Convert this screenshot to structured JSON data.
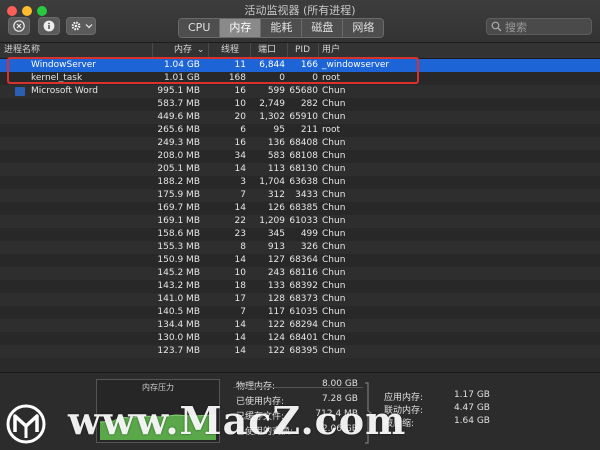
{
  "window": {
    "title": "活动监视器 (所有进程)"
  },
  "toolbar": {
    "close_icon": "x-circle-icon",
    "info_icon": "info-icon",
    "gear_icon": "gear-icon",
    "tabs": [
      {
        "label": "CPU",
        "active": false
      },
      {
        "label": "内存",
        "active": true
      },
      {
        "label": "能耗",
        "active": false
      },
      {
        "label": "磁盘",
        "active": false
      },
      {
        "label": "网络",
        "active": false
      }
    ],
    "search_placeholder": "搜索"
  },
  "table": {
    "headers": {
      "name": "进程名称",
      "memory": "内存",
      "threads": "线程",
      "ports": "端口",
      "pid": "PID",
      "user": "用户"
    },
    "sort_indicator": "⌄",
    "rows": [
      {
        "name": "WindowServer",
        "memory": "1.04 GB",
        "threads": "11",
        "ports": "6,844",
        "pid": "166",
        "user": "_windowserver",
        "selected": true
      },
      {
        "name": "kernel_task",
        "memory": "1.01 GB",
        "threads": "168",
        "ports": "0",
        "pid": "0",
        "user": "root"
      },
      {
        "name": "Microsoft Word",
        "memory": "995.1 MB",
        "threads": "16",
        "ports": "599",
        "pid": "65680",
        "user": "Chun",
        "icon": "word-icon"
      },
      {
        "name": "",
        "memory": "583.7 MB",
        "threads": "10",
        "ports": "2,749",
        "pid": "282",
        "user": "Chun"
      },
      {
        "name": "",
        "memory": "449.6 MB",
        "threads": "20",
        "ports": "1,302",
        "pid": "65910",
        "user": "Chun"
      },
      {
        "name": "",
        "memory": "265.6 MB",
        "threads": "6",
        "ports": "95",
        "pid": "211",
        "user": "root"
      },
      {
        "name": "",
        "memory": "249.3 MB",
        "threads": "16",
        "ports": "136",
        "pid": "68408",
        "user": "Chun"
      },
      {
        "name": "",
        "memory": "208.0 MB",
        "threads": "34",
        "ports": "583",
        "pid": "68108",
        "user": "Chun"
      },
      {
        "name": "",
        "memory": "205.1 MB",
        "threads": "14",
        "ports": "113",
        "pid": "68130",
        "user": "Chun"
      },
      {
        "name": "",
        "memory": "188.2 MB",
        "threads": "3",
        "ports": "1,704",
        "pid": "63638",
        "user": "Chun"
      },
      {
        "name": "",
        "memory": "175.9 MB",
        "threads": "7",
        "ports": "312",
        "pid": "3433",
        "user": "Chun"
      },
      {
        "name": "",
        "memory": "169.7 MB",
        "threads": "14",
        "ports": "126",
        "pid": "68385",
        "user": "Chun"
      },
      {
        "name": "",
        "memory": "169.1 MB",
        "threads": "22",
        "ports": "1,209",
        "pid": "61033",
        "user": "Chun"
      },
      {
        "name": "",
        "memory": "158.6 MB",
        "threads": "23",
        "ports": "345",
        "pid": "499",
        "user": "Chun"
      },
      {
        "name": "",
        "memory": "155.3 MB",
        "threads": "8",
        "ports": "913",
        "pid": "326",
        "user": "Chun"
      },
      {
        "name": "",
        "memory": "150.9 MB",
        "threads": "14",
        "ports": "127",
        "pid": "68364",
        "user": "Chun"
      },
      {
        "name": "",
        "memory": "145.2 MB",
        "threads": "10",
        "ports": "243",
        "pid": "68116",
        "user": "Chun"
      },
      {
        "name": "",
        "memory": "143.2 MB",
        "threads": "18",
        "ports": "133",
        "pid": "68392",
        "user": "Chun"
      },
      {
        "name": "",
        "memory": "141.0 MB",
        "threads": "17",
        "ports": "128",
        "pid": "68373",
        "user": "Chun"
      },
      {
        "name": "",
        "memory": "140.5 MB",
        "threads": "7",
        "ports": "117",
        "pid": "61035",
        "user": "Chun"
      },
      {
        "name": "",
        "memory": "134.4 MB",
        "threads": "14",
        "ports": "122",
        "pid": "68294",
        "user": "Chun"
      },
      {
        "name": "",
        "memory": "130.0 MB",
        "threads": "14",
        "ports": "124",
        "pid": "68401",
        "user": "Chun"
      },
      {
        "name": "",
        "memory": "123.7 MB",
        "threads": "14",
        "ports": "122",
        "pid": "68395",
        "user": "Chun"
      }
    ]
  },
  "bottom": {
    "pressure_label": "内存压力",
    "pressure_color": "#4caf50",
    "physical_label": "物理内存:",
    "physical_value": "8.00 GB",
    "used_label": "已使用内存:",
    "used_value": "7.28 GB",
    "cached_label": "已缓存文件:",
    "cached_value": "712.4 MB",
    "swap_label": "已使用的交换:",
    "swap_value": "2.06 GB",
    "app_label": "应用内存:",
    "app_value": "1.17 GB",
    "wired_label": "联动内存:",
    "wired_value": "4.47 GB",
    "compressed_label": "被压缩:",
    "compressed_value": "1.64 GB"
  },
  "watermark": {
    "text": "www.MacZ.com",
    "logo_icon": "macz-logo-icon"
  }
}
